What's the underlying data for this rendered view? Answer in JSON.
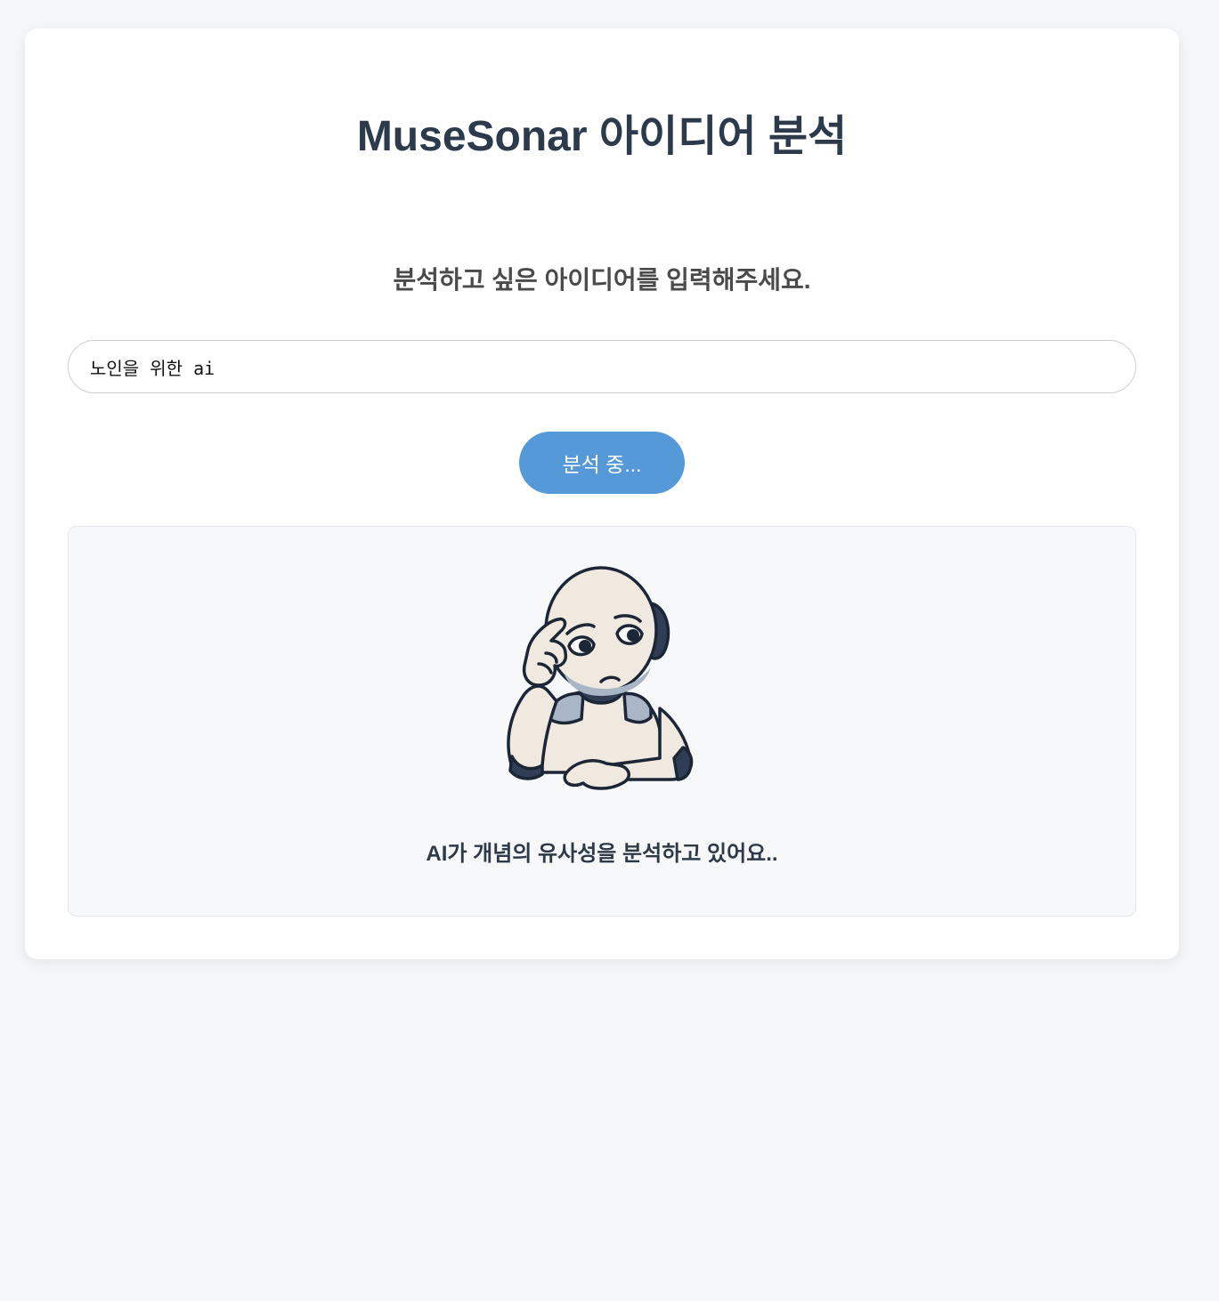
{
  "header": {
    "title": "MuseSonar 아이디어 분석"
  },
  "prompt": {
    "subtitle": "분석하고 싶은 아이디어를 입력해주세요."
  },
  "idea_input": {
    "value": "노인을 위한 ai"
  },
  "analyze_button": {
    "label": "분석 중..."
  },
  "result": {
    "illustration": "thinking-robot-icon",
    "status": "AI가 개념의 유사성을 분석하고 있어요.."
  },
  "colors": {
    "page_bg": "#f5f6f8",
    "card_bg": "#ffffff",
    "title": "#2c3a4b",
    "button_bg": "#5599d8",
    "panel_bg": "#f6f8fa"
  }
}
